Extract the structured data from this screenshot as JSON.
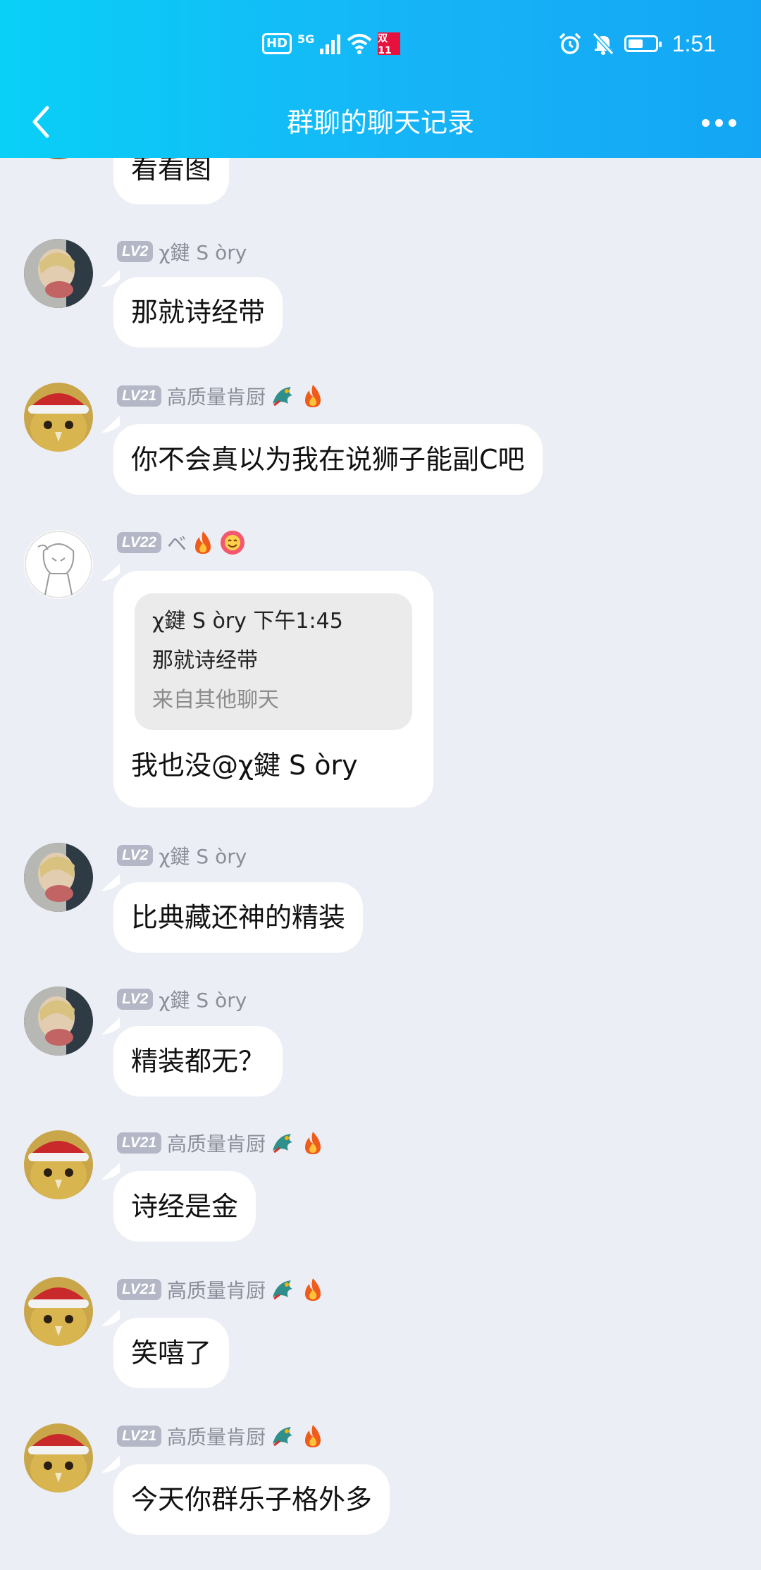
{
  "status_bar": {
    "hd": "HD",
    "network": "5G",
    "badge": "双11",
    "time": "1:51",
    "icons": [
      "hd-icon",
      "signal-icon",
      "wifi-icon",
      "double11-badge-icon",
      "alarm-icon",
      "mute-bell-icon",
      "battery-icon"
    ]
  },
  "nav": {
    "title": "群聊的聊天记录",
    "icons": [
      "chevron-left-icon",
      "more-dots-icon"
    ]
  },
  "messages": [
    {
      "text": "看看图"
    },
    {
      "level": "LV2",
      "name": "χ鍵 S òry",
      "text": "那就诗经带"
    },
    {
      "level": "LV21",
      "name": "高质量肯厨",
      "badges": [
        "dragon-icon",
        "fire-icon"
      ],
      "text": "你不会真以为我在说狮子能副C吧"
    },
    {
      "level": "LV22",
      "name": "ベ",
      "badges": [
        "fire-icon",
        "smile-flower-icon"
      ],
      "quote": {
        "header": "χ鍵 S òry 下午1:45",
        "body": "那就诗经带",
        "source": "来自其他聊天"
      },
      "text": "我也没@χ鍵 S òry"
    },
    {
      "level": "LV2",
      "name": "χ鍵 S òry",
      "text": "比典藏还神的精装"
    },
    {
      "level": "LV2",
      "name": "χ鍵 S òry",
      "text": "精装都无？"
    },
    {
      "level": "LV21",
      "name": "高质量肯厨",
      "badges": [
        "dragon-icon",
        "fire-icon"
      ],
      "text": "诗经是金"
    },
    {
      "level": "LV21",
      "name": "高质量肯厨",
      "badges": [
        "dragon-icon",
        "fire-icon"
      ],
      "text": "笑嘻了"
    },
    {
      "level": "LV21",
      "name": "高质量肯厨",
      "badges": [
        "dragon-icon",
        "fire-icon"
      ],
      "text": "今天你群乐子格外多"
    }
  ],
  "colors": {
    "header_start": "#09d0f7",
    "header_end": "#14a6f4",
    "background": "#eceef5",
    "bubble": "#ffffff",
    "quote_bg": "#ebebeb",
    "level_badge": "#b3b7c6",
    "nickname": "#8a8e99"
  }
}
